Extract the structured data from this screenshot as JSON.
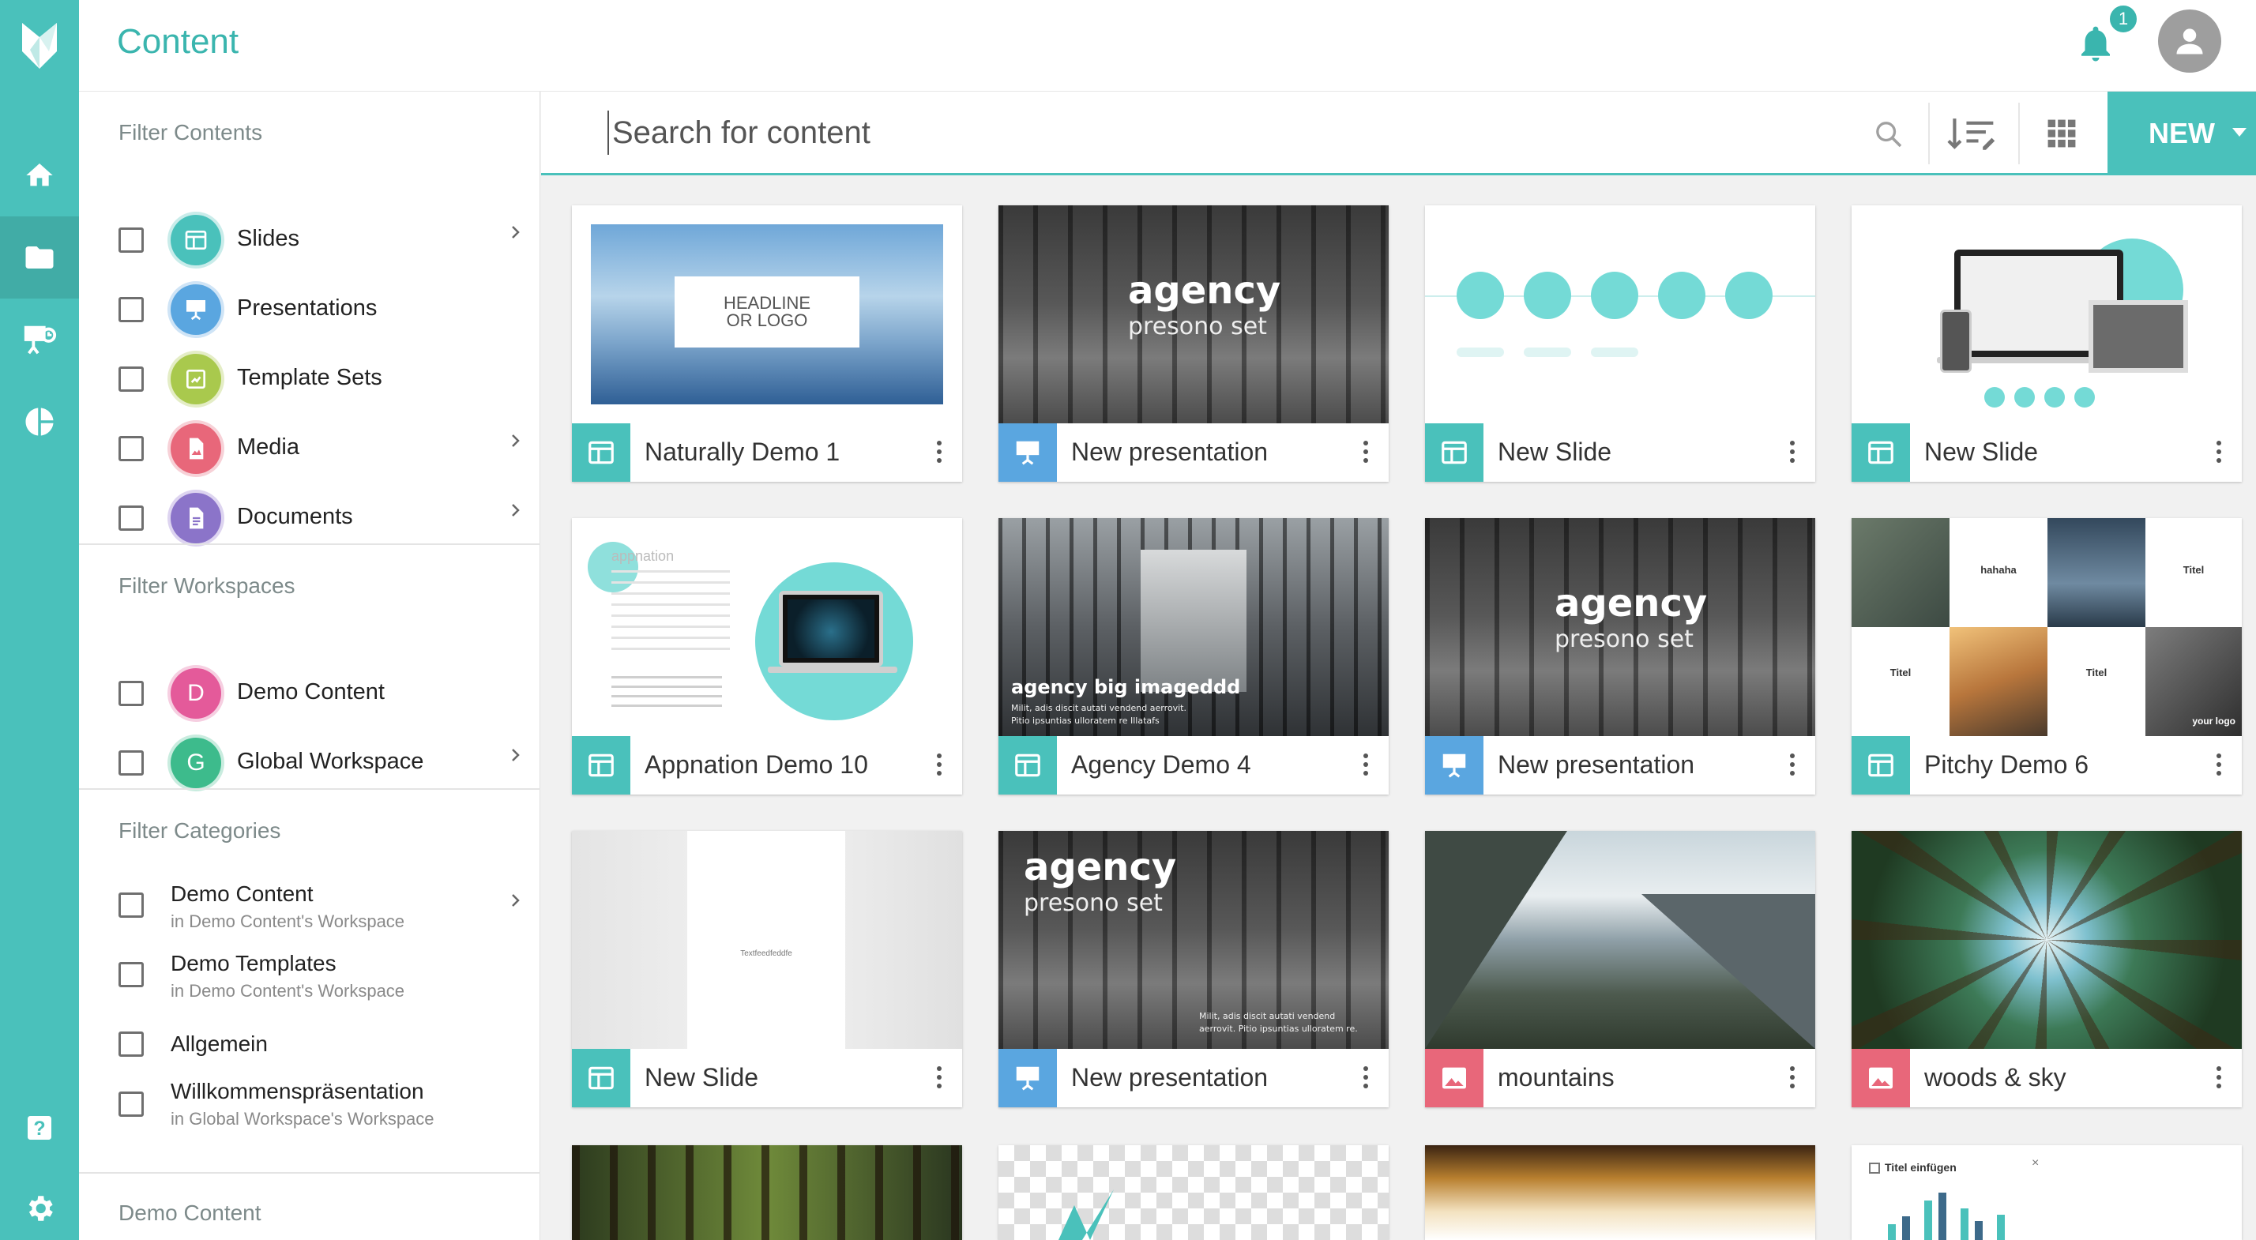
{
  "header": {
    "title": "Content",
    "notifications_count": "1"
  },
  "colors": {
    "accent": "#4ac1bb",
    "slides": "#4ac1bb",
    "presentations": "#5aa6e0",
    "template_sets": "#a9c94d",
    "media": "#e8677a",
    "documents": "#8b74c9",
    "workspace_demo": "#e45a9a",
    "workspace_global": "#3dbb8c"
  },
  "filters": {
    "contents_heading": "Filter Contents",
    "contents": [
      {
        "label": "Slides",
        "icon": "slide-layout-icon",
        "expandable": true
      },
      {
        "label": "Presentations",
        "icon": "presentation-icon",
        "expandable": false
      },
      {
        "label": "Template Sets",
        "icon": "template-icon",
        "expandable": false
      },
      {
        "label": "Media",
        "icon": "image-file-icon",
        "expandable": true
      },
      {
        "label": "Documents",
        "icon": "document-icon",
        "expandable": true
      }
    ],
    "workspaces_heading": "Filter Workspaces",
    "workspaces": [
      {
        "label": "Demo Content",
        "letter": "D",
        "expandable": false
      },
      {
        "label": "Global Workspace",
        "letter": "G",
        "expandable": true
      }
    ],
    "categories_heading": "Filter Categories",
    "categories": [
      {
        "label": "Demo Content",
        "sub": "in Demo Content's Workspace",
        "expandable": true
      },
      {
        "label": "Demo Templates",
        "sub": "in Demo Content's Workspace",
        "expandable": false
      },
      {
        "label": "Allgemein",
        "sub": "",
        "expandable": false
      },
      {
        "label": "Willkommenspräsentation",
        "sub": "in Global Workspace's Workspace",
        "expandable": false
      }
    ],
    "bottom_heading": "Demo Content"
  },
  "search": {
    "placeholder": "Search for content"
  },
  "new_button": "NEW",
  "cards": [
    {
      "name": "Naturally Demo 1",
      "type": "slide",
      "thumb_text": [
        "HEADLINE",
        "OR LOGO"
      ]
    },
    {
      "name": "New presentation",
      "type": "presentation",
      "thumb_text": [
        "agency",
        "presono set"
      ]
    },
    {
      "name": "New Slide",
      "type": "slide",
      "thumb_text": []
    },
    {
      "name": "New Slide",
      "type": "slide",
      "thumb_text": []
    },
    {
      "name": "Appnation Demo 10",
      "type": "slide",
      "thumb_text": [
        "appnation"
      ]
    },
    {
      "name": "Agency Demo 4",
      "type": "slide",
      "thumb_text": [
        "agency big imageddd",
        "Milit, adis discit autati vendend aerrovit.",
        "Pitio ipsuntias ulloratem re Illatafs"
      ]
    },
    {
      "name": "New presentation",
      "type": "presentation",
      "thumb_text": [
        "agency",
        "presono set"
      ]
    },
    {
      "name": "Pitchy Demo 6",
      "type": "slide",
      "thumb_text": [
        "hahaha",
        "Titel",
        "Titel",
        "Titel",
        "your logo"
      ]
    },
    {
      "name": "New Slide",
      "type": "slide",
      "thumb_text": [
        "Textfeedfeddfe"
      ]
    },
    {
      "name": "New presentation",
      "type": "presentation",
      "thumb_text": [
        "agency",
        "presono set",
        "Milit, adis discit autati vendend",
        "aerrovit. Pitio ipsuntias ulloratem re."
      ]
    },
    {
      "name": "mountains",
      "type": "media",
      "thumb_text": []
    },
    {
      "name": "woods & sky",
      "type": "media",
      "thumb_text": []
    }
  ],
  "partial_row": {
    "chart_title": "Titel einfügen"
  }
}
